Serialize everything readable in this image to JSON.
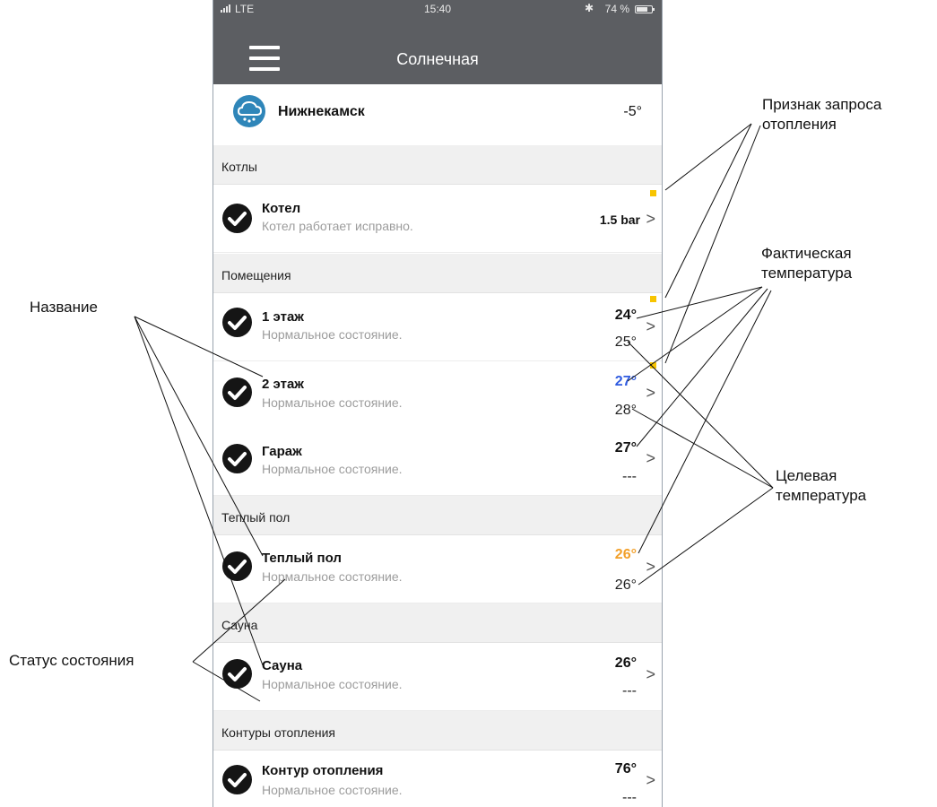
{
  "status_bar": {
    "carrier": "LTE",
    "time": "15:40",
    "battery": "74 %"
  },
  "header": {
    "title": "Солнечная"
  },
  "weather": {
    "icon": "weather-snow-icon",
    "city": "Нижнекамск",
    "temperature": "-5°"
  },
  "sections": {
    "boilers": {
      "title": "Котлы",
      "rows": [
        {
          "name": "Котел",
          "status": "Котел работает исправно.",
          "value": "1.5 bar"
        }
      ]
    },
    "rooms": {
      "title": "Помещения",
      "rows": [
        {
          "name": "1 этаж",
          "status": "Нормальное состояние.",
          "actual": "24°",
          "target": "25°"
        },
        {
          "name": "2 этаж",
          "status": "Нормальное состояние.",
          "actual": "27°",
          "target": "28°"
        },
        {
          "name": "Гараж",
          "status": "Нормальное состояние.",
          "actual": "27°",
          "target": "---"
        }
      ]
    },
    "floor": {
      "title": "Теплый пол",
      "rows": [
        {
          "name": "Теплый пол",
          "status": "Нормальное состояние.",
          "actual": "26°",
          "target": "26°"
        }
      ]
    },
    "sauna": {
      "title": "Сауна",
      "rows": [
        {
          "name": "Сауна",
          "status": "Нормальное состояние.",
          "actual": "26°",
          "target": "---"
        }
      ]
    },
    "circuits": {
      "title": "Контуры отопления",
      "rows": [
        {
          "name": "Контур отопления",
          "status": "Нормальное состояние.",
          "actual": "76°",
          "target": "---"
        }
      ]
    }
  },
  "annotations": {
    "heat_request": "Признак запроса\nотопления",
    "actual_temp": "Фактическая\nтемпература",
    "target_temp": "Целевая\nтемпература",
    "name": "Название",
    "status": "Статус состояния"
  },
  "colors": {
    "header_bg": "#5c5e62",
    "heat_request_flag": "#f7c400",
    "blue_temp": "#2f5be0",
    "orange_temp": "#f2a02a",
    "weather_icon": "#2f86b9"
  }
}
